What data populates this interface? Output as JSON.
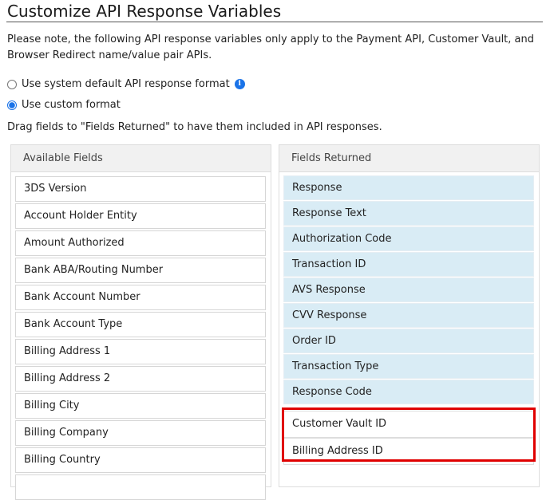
{
  "title": "Customize API Response Variables",
  "note": "Please note, the following API response variables only apply to the Payment API, Customer Vault, and Browser Redirect name/value pair APIs.",
  "options": [
    {
      "label": "Use system default API response format",
      "selected": false
    },
    {
      "label": "Use custom format",
      "selected": true
    }
  ],
  "info_icon": "i",
  "drag_hint": "Drag fields to \"Fields Returned\" to have them included in API responses.",
  "available": {
    "header": "Available Fields",
    "items": [
      "3DS Version",
      "Account Holder Entity",
      "Amount Authorized",
      "Bank ABA/Routing Number",
      "Bank Account Number",
      "Bank Account Type",
      "Billing Address 1",
      "Billing Address 2",
      "Billing City",
      "Billing Company",
      "Billing Country",
      ""
    ]
  },
  "returned": {
    "header": "Fields Returned",
    "items": [
      "Response",
      "Response Text",
      "Authorization Code",
      "Transaction ID",
      "AVS Response",
      "CVV Response",
      "Order ID",
      "Transaction Type",
      "Response Code"
    ],
    "new_items": [
      "Customer Vault ID",
      "Billing Address ID"
    ]
  },
  "colors": {
    "highlight": "#e00000",
    "returned_bg": "#d9ecf5",
    "accent": "#1a73e8"
  }
}
